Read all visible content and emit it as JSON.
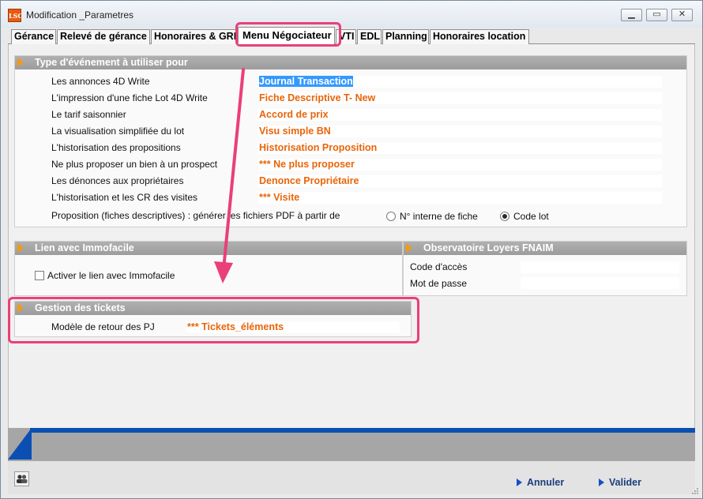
{
  "window": {
    "title": "Modification _Parametres",
    "app_icon_text": "LSC"
  },
  "tabs": [
    {
      "label": "Gérance",
      "active": false
    },
    {
      "label": "Relevé de gérance",
      "active": false
    },
    {
      "label": "Honoraires & GRL",
      "active": false
    },
    {
      "label": "Menu Négociateur",
      "active": true
    },
    {
      "label": "VTI",
      "active": false
    },
    {
      "label": "EDL",
      "active": false
    },
    {
      "label": "Planning",
      "active": false
    },
    {
      "label": "Honoraires location",
      "active": false
    }
  ],
  "event_section": {
    "title": "Type d'événement à utiliser pour",
    "rows": [
      {
        "label": "Les annonces 4D Write",
        "value": "Journal Transaction"
      },
      {
        "label": "L'impression d'une fiche Lot 4D Write",
        "value": "Fiche Descriptive T- New"
      },
      {
        "label": "Le tarif saisonnier",
        "value": "Accord de prix"
      },
      {
        "label": "La visualisation simplifiée du lot",
        "value": "Visu simple BN"
      },
      {
        "label": "L'historisation des propositions",
        "value": "Historisation Proposition"
      },
      {
        "label": "Ne plus proposer un bien à un prospect",
        "value": "*** Ne plus proposer"
      },
      {
        "label": "Les dénonces aux propriétaires",
        "value": "Denonce Propriétaire"
      },
      {
        "label": "L'historisation et les CR des visites",
        "value": "*** Visite"
      }
    ],
    "pdf_label": "Proposition (fiches descriptives) : générer les fichiers PDF à partir de",
    "radio_options": [
      {
        "label": "N° interne de fiche",
        "checked": false
      },
      {
        "label": "Code lot",
        "checked": true
      }
    ]
  },
  "immofacile_section": {
    "title": "Lien avec Immofacile",
    "checkbox_label": "Activer le lien avec Immofacile",
    "checked": false
  },
  "fnaim_section": {
    "title": "Observatoire Loyers FNAIM",
    "access_code_label": "Code d'accès",
    "password_label": "Mot de passe",
    "access_code_value": "",
    "password_value": ""
  },
  "tickets_section": {
    "title": "Gestion des tickets",
    "label": "Modèle de retour des PJ",
    "value": "*** Tickets_éléments"
  },
  "footer": {
    "cancel_label": "Annuler",
    "validate_label": "Valider"
  },
  "colors": {
    "accent_orange": "#e8650a",
    "highlight_pink": "#ea3f78",
    "footer_blue": "#0b4fb3",
    "selection_blue": "#3399ff"
  }
}
